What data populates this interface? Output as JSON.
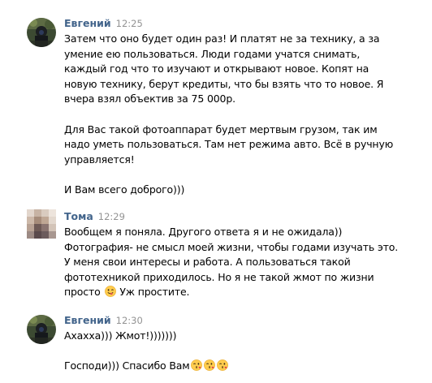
{
  "messages": [
    {
      "author": "Евгений",
      "time": "12:25",
      "lines": [
        "Затем что оно будет один раз! И платят не за технику, а за",
        "умение ею пользоваться. Люди годами учатся снимать,",
        "каждый год что то изучают и открывают новое. Копят на",
        "новую технику, берут кредиты, что бы взять что то новое. Я",
        "вчера взял объектив за 75 000р.",
        "",
        "Для Вас такой фотоаппарат будет мертвым грузом, так им",
        "надо уметь пользоваться. Там нет режима авто. Всё в ручную",
        "управляется!",
        "",
        "И Вам всего доброго)))"
      ]
    },
    {
      "author": "Тома",
      "time": "12:29",
      "lines": [
        "Вообщем я поняла. Другого ответа я и не ожидала))",
        "Фотография- не смысл моей жизни, чтобы годами изучать это.",
        "У меня свои интересы и работа. А пользоваться такой",
        "фототехникой приходилось. Но я не такой жмот по жизни"
      ],
      "last_line_before": "просто",
      "last_line_after": "Уж простите."
    },
    {
      "author": "Евгений",
      "time": "12:30",
      "lines": [
        "Ахахха))) Жмот!)))))))",
        ""
      ],
      "last_line_before": "Господи))) Спасибо Вам"
    }
  ],
  "emoji": {
    "wink_tongue": "wink-tongue-emoji",
    "kiss": "kiss-emoji"
  },
  "colors": {
    "author": "#42648b",
    "time": "#939393",
    "text": "#000000",
    "background": "#ffffff"
  }
}
